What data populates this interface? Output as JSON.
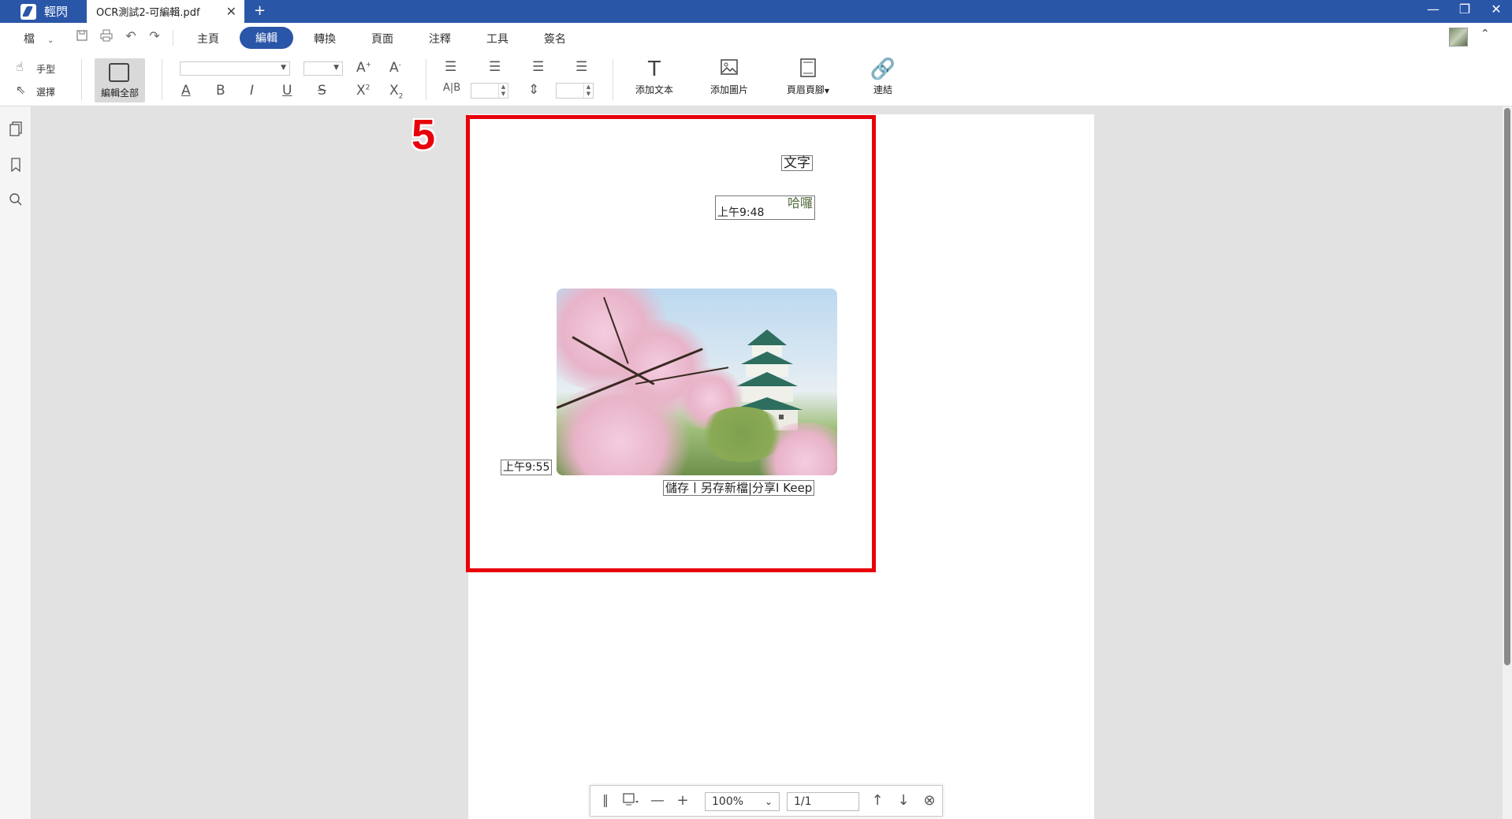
{
  "titlebar": {
    "app_name": "輕閃",
    "doc_tab": "OCR測試2-可編輯.pdf",
    "close_tab": "✕",
    "new_tab": "+",
    "win_min": "—",
    "win_restore": "❐",
    "win_close": "✕"
  },
  "menu": {
    "file": "檔",
    "tabs": [
      "主頁",
      "編輯",
      "轉換",
      "頁面",
      "注釋",
      "工具",
      "簽名"
    ]
  },
  "ribbon": {
    "hand": "手型",
    "select": "選擇",
    "edit_all": "編輯全部",
    "add_text": "添加文本",
    "add_image": "添加圖片",
    "header_footer": "頁眉頁腳",
    "link": "連結"
  },
  "document": {
    "callout_number": "5",
    "text_boxes": {
      "wenzi": "文字",
      "haluo": "哈囉",
      "time1": "上午9:48",
      "time2": "上午9:55",
      "bottom": "儲存丨另存新檔|分享I Keep"
    }
  },
  "bottom_toolbar": {
    "zoom": "100%",
    "page": "1/1"
  }
}
